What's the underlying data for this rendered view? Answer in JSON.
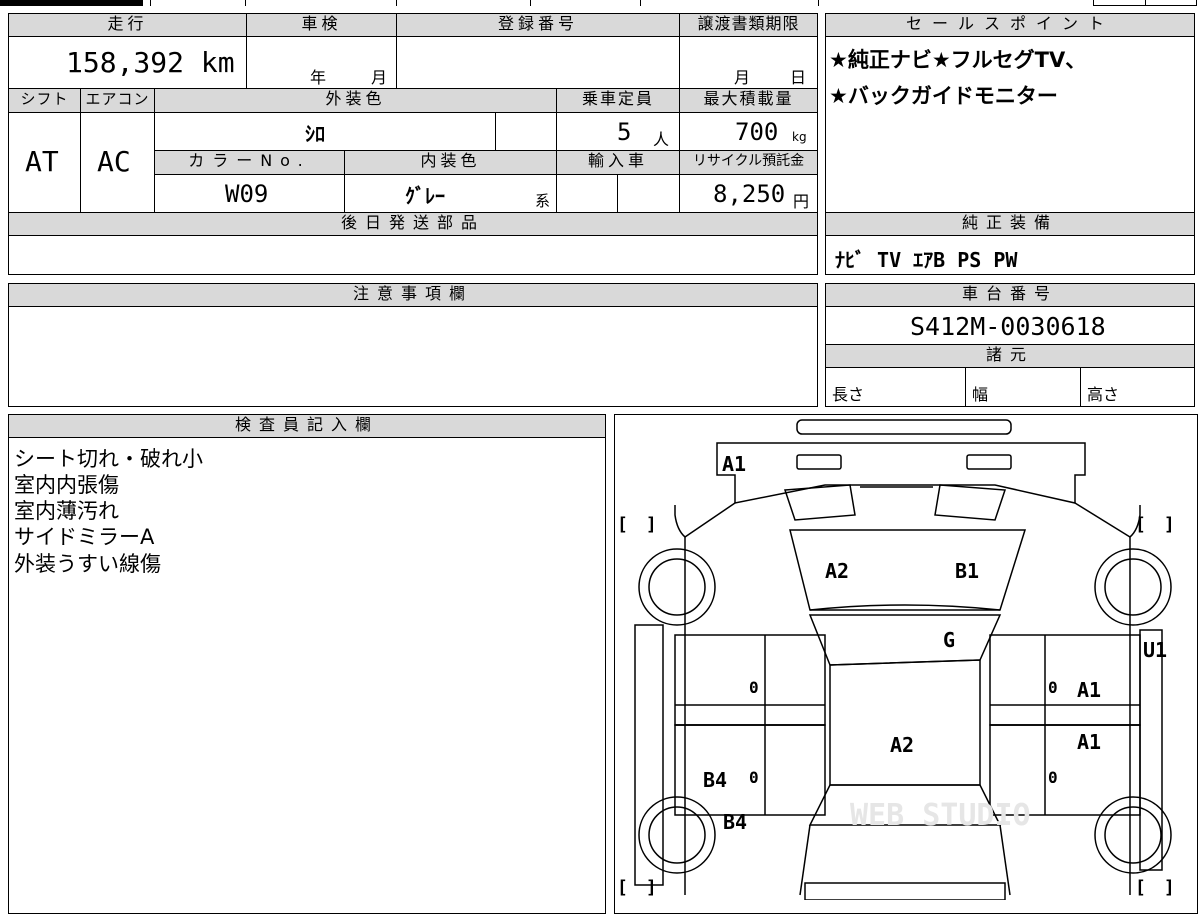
{
  "top_table": {
    "mileage_label": "走行",
    "mileage_value": "158,392 km",
    "inspection_label": "車検",
    "inspection_year": "年",
    "inspection_month": "月",
    "registration_label": "登録番号",
    "transfer_label": "譲渡書類期限",
    "transfer_month": "月",
    "transfer_day": "日",
    "shift_label": "シフト",
    "shift_value": "AT",
    "ac_label": "エアコン",
    "ac_value": "AC",
    "exterior_label": "外装色",
    "exterior_value": "ｼﾛ",
    "capacity_label": "乗車定員",
    "capacity_value": "5",
    "capacity_unit": "人",
    "load_label": "最大積載量",
    "load_value": "700",
    "load_unit": "kg",
    "color_no_label": "カラーNo.",
    "color_no_value": "W09",
    "interior_label": "内装色",
    "interior_value": "ｸﾞﾚｰ",
    "interior_suffix": "系",
    "import_label": "輸入車",
    "recycle_label": "リサイクル預託金",
    "recycle_value": "8,250",
    "recycle_unit": "円",
    "later_parts_label": "後日発送部品"
  },
  "sales_point": {
    "label": "セールスポイント",
    "lines": [
      "★純正ナビ★フルセグTV、",
      "★バックガイドモニター"
    ]
  },
  "equipment": {
    "label": "純正装備",
    "value": "ﾅﾋﾞ TV ｴｱB PS PW"
  },
  "notes": {
    "label": "注意事項欄"
  },
  "chassis": {
    "label": "車台番号",
    "value": "S412M-0030618"
  },
  "specs": {
    "label": "諸元",
    "length": "長さ",
    "width": "幅",
    "height": "高さ"
  },
  "inspector": {
    "label": "検査員記入欄",
    "lines": [
      "シート切れ・破れ小",
      "室内内張傷",
      "室内薄汚れ",
      "サイドミラーA",
      "外装うすい線傷"
    ]
  },
  "diagram": {
    "marks": {
      "front_bumper": "A1",
      "hood_left": "A2",
      "hood_right": "B1",
      "windshield": "G",
      "right_edge": "U1",
      "right_front_door": "A1",
      "roof": "A2",
      "right_rear_door": "A1",
      "left_rear_door": "B4",
      "left_rear_fender": "B4",
      "left_front_zero": "0",
      "left_rear_zero": "0",
      "right_front_zero": "0",
      "right_rear_zero": "0"
    },
    "brackets": {
      "left_top": "[　]",
      "right_top": "[　]",
      "left_bottom": "[　]",
      "right_bottom": "[　]"
    },
    "watermark": "WEB STUDIO"
  }
}
